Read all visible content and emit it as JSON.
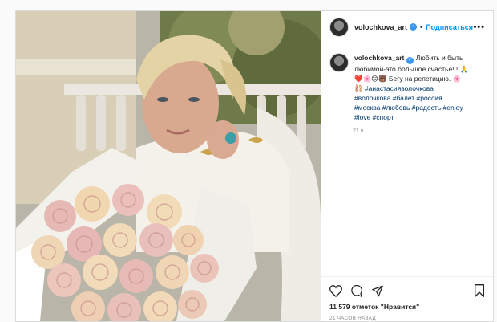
{
  "post": {
    "username": "volochkova_art",
    "follow_label": "Подписаться",
    "dot": "•",
    "more": "•••",
    "caption_text": "Любить и быть любимой-это большое счастье!!! 🙏\n❤️🌸😊🐻 Бегу на репетицию. 🌸\n🩰 ",
    "hashtags": "#анастасияволочкова\n#волочкова #балет #россия\n#москва #любовь #радость #enjoy\n#love #спорт",
    "comment_time": "21 ч.",
    "likes": "11 579 отметок \"Нравится\"",
    "posted_ago": "21 ЧАСОВ НАЗАД"
  },
  "colors": {
    "accent": "#0095f6",
    "verified": "#3897f0",
    "hashtag": "#00376b"
  },
  "icons": [
    "heart-icon",
    "comment-icon",
    "share-icon",
    "bookmark-icon",
    "verified-icon",
    "more-icon"
  ]
}
